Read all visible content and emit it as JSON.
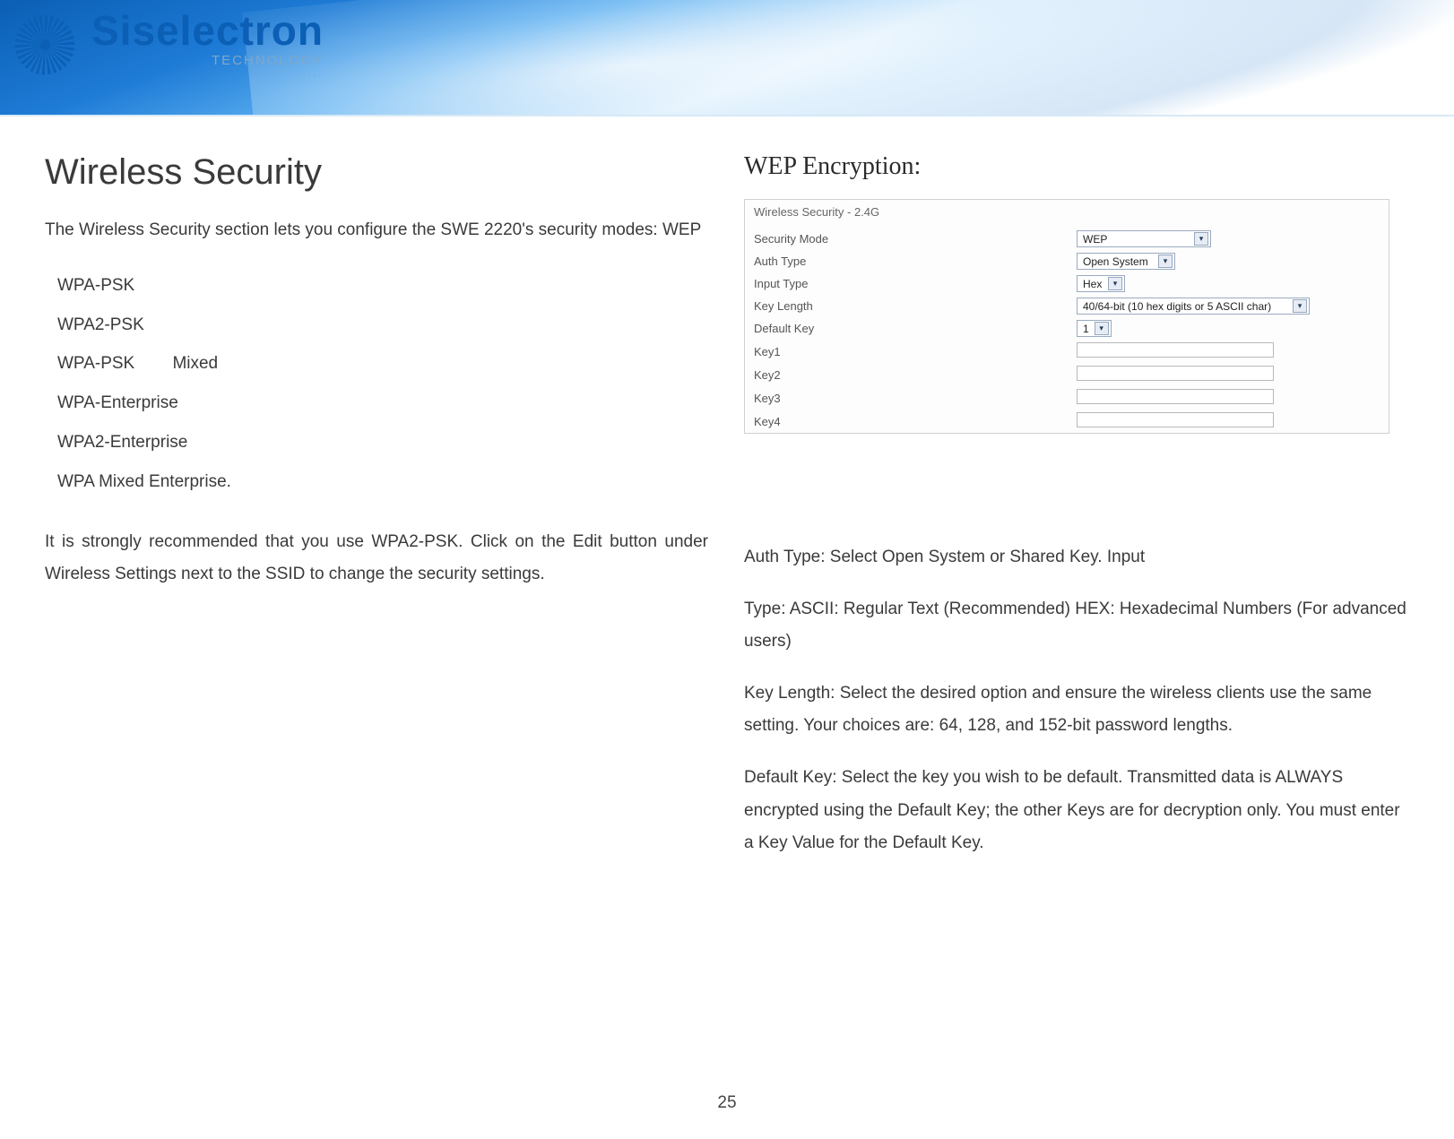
{
  "brand": {
    "name": "Siselectron",
    "tagline": "TECHNOLOGY",
    "dots": "·····"
  },
  "left": {
    "title": "Wireless Security",
    "intro": "The  Wireless  Security  section  lets  you  configure  the SWE 2220's security modes: WEP",
    "modes": [
      "WPA-PSK",
      "WPA2-PSK",
      "WPA-PSK        Mixed",
      "WPA-Enterprise",
      "WPA2-Enterprise",
      "WPA Mixed Enterprise."
    ],
    "reco": "It is strongly  recommended that  you  use  WPA2-PSK.  Click on the  Edit button under  Wireless  Settings next   to  the  SSID to  change   the security settings."
  },
  "right": {
    "title": "WEP Encryption:",
    "shot": {
      "heading": "Wireless Security - 2.4G",
      "rows": {
        "security_mode": {
          "label": "Security Mode",
          "value": "WEP"
        },
        "auth_type": {
          "label": "Auth Type",
          "value": "Open System"
        },
        "input_type": {
          "label": "Input Type",
          "value": "Hex"
        },
        "key_length": {
          "label": "Key Length",
          "value": "40/64-bit (10 hex digits or 5 ASCII char)"
        },
        "default_key": {
          "label": "Default Key",
          "value": "1"
        },
        "key1": {
          "label": "Key1"
        },
        "key2": {
          "label": "Key2"
        },
        "key3": {
          "label": "Key3"
        },
        "key4": {
          "label": "Key4"
        }
      }
    },
    "para_auth": "Auth  Type:  Select  Open  System or Shared Key. Input",
    "para_input": "Type: ASCII:  Regular  Text  (Recommended) HEX: Hexadecimal Numbers  (For advanced users)",
    "para_keylen": "Key  Length:  Select   the   desired   option   and  ensure  the wireless clients  use  the  same  setting. Your choices  are:  64, 128,  and  152-bit password lengths.",
    "para_default": "Default Key:  Select   the   key  you  wish  to  be  default. Transmitted data  is ALWAYS encrypted using  the  Default Key; the  other Keys are for decryption only.  You must  enter a Key  Value for  the Default  Key."
  },
  "page_number": "25"
}
